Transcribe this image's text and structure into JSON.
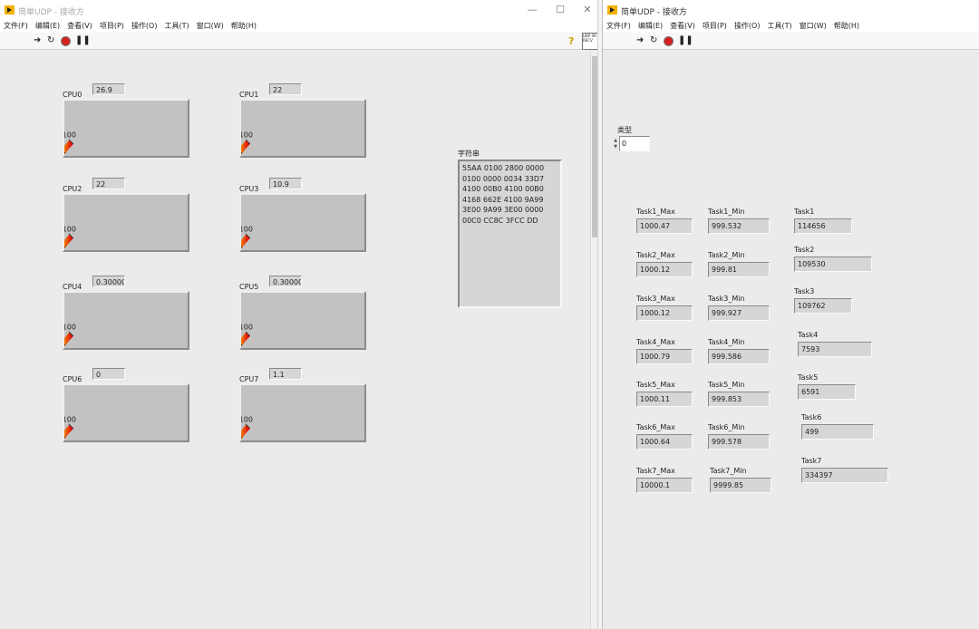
{
  "left_window": {
    "title": "简单UDP - 接收方",
    "menu": [
      "文件(F)",
      "编辑(E)",
      "查看(V)",
      "项目(P)",
      "操作(O)",
      "工具(T)",
      "窗口(W)",
      "帮助(H)"
    ],
    "window_controls": {
      "minimize": "—",
      "maximize": "☐",
      "close": "✕"
    },
    "vi_icon_text": [
      "UDP SR",
      "RECV"
    ],
    "gauges": [
      {
        "label": "CPU0",
        "value": 26.9,
        "display": "26.9"
      },
      {
        "label": "CPU1",
        "value": 22,
        "display": "22"
      },
      {
        "label": "CPU2",
        "value": 22,
        "display": "22"
      },
      {
        "label": "CPU3",
        "value": 10.9,
        "display": "10.9"
      },
      {
        "label": "CPU4",
        "value": 0.3,
        "display": "0.30000"
      },
      {
        "label": "CPU5",
        "value": 0.3,
        "display": "0.30000"
      },
      {
        "label": "CPU6",
        "value": 0,
        "display": "0"
      },
      {
        "label": "CPU7",
        "value": 1.1,
        "display": "1.1"
      }
    ],
    "gauge_scale": {
      "ticks": [
        "0",
        "20",
        "40",
        "60",
        "80",
        "100"
      ],
      "min": 0,
      "max": 100
    },
    "string": {
      "label": "字符串",
      "lines": [
        "55AA 0100 2800 0000",
        "0100 0000 0034 33D7",
        "4100 00B0 4100 00B0",
        "4168 662E 4100 9A99",
        "3E00 9A99 3E00 0000",
        "00C0 CC8C 3FCC DD"
      ]
    }
  },
  "right_window": {
    "title": "简单UDP - 接收方",
    "menu": [
      "文件(F)",
      "编辑(E)",
      "查看(V)",
      "项目(P)",
      "操作(O)",
      "工具(T)",
      "窗口(W)",
      "帮助(H)"
    ],
    "type": {
      "label": "类型",
      "value": "0"
    },
    "tasks": [
      {
        "max_label": "Task1_Max",
        "max": "1000.47",
        "min_label": "Task1_Min",
        "min": "999.532",
        "total_label": "Task1",
        "total": "114656"
      },
      {
        "max_label": "Task2_Max",
        "max": "1000.12",
        "min_label": "Task2_Min",
        "min": "999.81",
        "total_label": "Task2",
        "total": "109530"
      },
      {
        "max_label": "Task3_Max",
        "max": "1000.12",
        "min_label": "Task3_Min",
        "min": "999.927",
        "total_label": "Task3",
        "total": "109762"
      },
      {
        "max_label": "Task4_Max",
        "max": "1000.79",
        "min_label": "Task4_Min",
        "min": "999.586",
        "total_label": "Task4",
        "total": "7593"
      },
      {
        "max_label": "Task5_Max",
        "max": "1000.11",
        "min_label": "Task5_Min",
        "min": "999.853",
        "total_label": "Task5",
        "total": "6591"
      },
      {
        "max_label": "Task6_Max",
        "max": "1000.64",
        "min_label": "Task6_Min",
        "min": "999.578",
        "total_label": "Task6",
        "total": "499"
      },
      {
        "max_label": "Task7_Max",
        "max": "10000.1",
        "min_label": "Task7_Min",
        "min": "9999.85",
        "total_label": "Task7",
        "total": "334397"
      }
    ]
  },
  "colors": {
    "gauge_low": "#22cc22",
    "gauge_mid": "#ffd400",
    "gauge_high": "#e01010",
    "needle": "#ff1a1a"
  }
}
